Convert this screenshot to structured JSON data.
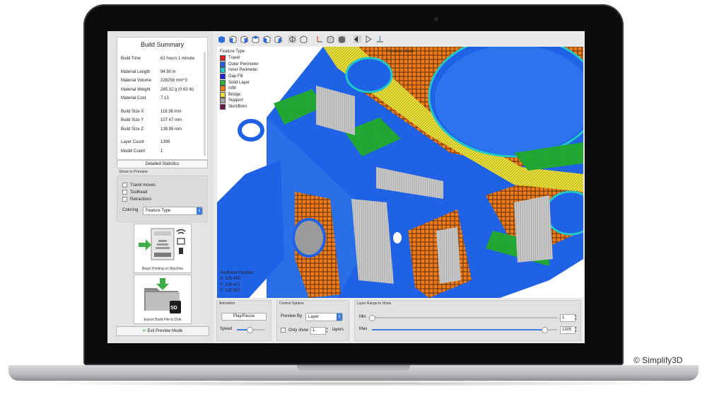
{
  "watermark": "© Simplify3D",
  "summary": {
    "title": "Build Summary",
    "rows": [
      {
        "k": "Build Time",
        "v": "63 hours 1 minute"
      },
      {
        "k": "Material Length",
        "v": "94.90 m"
      },
      {
        "k": "Material Volume",
        "v": "228258 mm^3"
      },
      {
        "k": "Material Weight",
        "v": "285.32 g (0.63 lb)"
      },
      {
        "k": "Material Cost",
        "v": "7.13"
      },
      {
        "k": "Build Size X",
        "v": "118.36 mm"
      },
      {
        "k": "Build Size Y",
        "v": "107.47 mm"
      },
      {
        "k": "Build Size Z",
        "v": "139.95 mm"
      },
      {
        "k": "Layer Count",
        "v": "1399"
      },
      {
        "k": "Model Count",
        "v": "1"
      }
    ],
    "detailed_label": "Detailed Statistics"
  },
  "show_in_preview": {
    "label": "Show in Preview",
    "travel": "Travel moves",
    "toolhead": "Toolhead",
    "retractions": "Retractions",
    "coloring_label": "Coloring",
    "coloring_value": "Feature Type"
  },
  "actions": {
    "print_label": "Begin Printing on Machine",
    "export_label": "Export Build File to Disk",
    "sd_label": "SD",
    "exit_label": "Exit Preview Mode"
  },
  "viewport": {
    "preview_mode": "Preview Mode",
    "legend_title": "Feature Type",
    "legend": [
      {
        "name": "Travel",
        "color": "#e0201f"
      },
      {
        "name": "Outer Perimeter",
        "color": "#1f62e6"
      },
      {
        "name": "Inner Perimeter",
        "color": "#22c7c9"
      },
      {
        "name": "Gap Fill",
        "color": "#1d1ed0"
      },
      {
        "name": "Solid Layer",
        "color": "#27b43a"
      },
      {
        "name": "Infill",
        "color": "#f27c19"
      },
      {
        "name": "Bridge",
        "color": "#e6dd3b"
      },
      {
        "name": "Support",
        "color": "#a6a6a6"
      },
      {
        "name": "Skirt/Brim",
        "color": "#6a1a4a"
      }
    ],
    "toolhead_title": "Toolhead Position",
    "toolhead_x": "X: 125.440",
    "toolhead_y": "Y: 108.472",
    "toolhead_z": "Z: 130.550"
  },
  "animation": {
    "title": "Animation",
    "play_label": "Play/Pause",
    "speed_label": "Speed",
    "speed_level": 0.45
  },
  "control": {
    "title": "Control Options",
    "preview_by_label": "Preview By",
    "preview_by_value": "Layer",
    "only_show_label": "Only show",
    "only_show_value": "1",
    "layers_label": "layers"
  },
  "layer_range": {
    "title": "Layer Range to Show",
    "min_label": "Min",
    "min_value": "1",
    "max_label": "Max",
    "max_value": "1305",
    "min_fraction": 0.0,
    "max_fraction": 0.932
  }
}
